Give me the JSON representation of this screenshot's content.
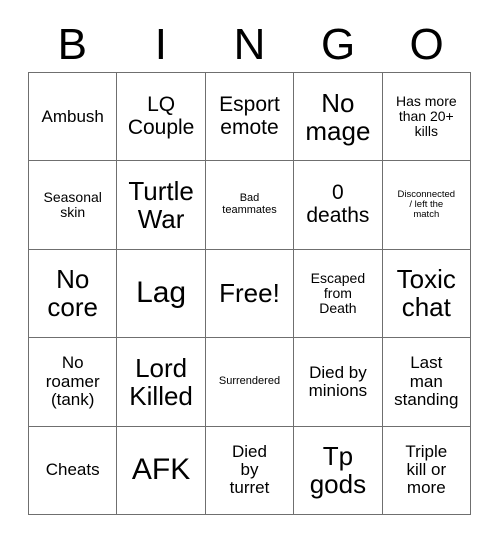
{
  "card": {
    "title": "BINGO",
    "headers": [
      "B",
      "I",
      "N",
      "G",
      "O"
    ],
    "rows": [
      [
        {
          "text": "Ambush",
          "size": "fs-m"
        },
        {
          "text": "LQ\nCouple",
          "size": "fs-l"
        },
        {
          "text": "Esport\nemote",
          "size": "fs-l"
        },
        {
          "text": "No\nmage",
          "size": "fs-xl"
        },
        {
          "text": "Has more\nthan 20+\nkills",
          "size": "fs-s"
        }
      ],
      [
        {
          "text": "Seasonal\nskin",
          "size": "fs-s"
        },
        {
          "text": "Turtle\nWar",
          "size": "fs-xl"
        },
        {
          "text": "Bad\nteammates",
          "size": "fs-xs"
        },
        {
          "text": "0\ndeaths",
          "size": "fs-l"
        },
        {
          "text": "Disconnected\n/ left the\nmatch",
          "size": "fs-xxs"
        }
      ],
      [
        {
          "text": "No\ncore",
          "size": "fs-xl"
        },
        {
          "text": "Lag",
          "size": "fs-xxl"
        },
        {
          "text": "Free!",
          "size": "fs-xl"
        },
        {
          "text": "Escaped\nfrom\nDeath",
          "size": "fs-s"
        },
        {
          "text": "Toxic\nchat",
          "size": "fs-xl"
        }
      ],
      [
        {
          "text": "No\nroamer\n(tank)",
          "size": "fs-m"
        },
        {
          "text": "Lord\nKilled",
          "size": "fs-xl"
        },
        {
          "text": "Surrendered",
          "size": "fs-xs"
        },
        {
          "text": "Died by\nminions",
          "size": "fs-m"
        },
        {
          "text": "Last\nman\nstanding",
          "size": "fs-m"
        }
      ],
      [
        {
          "text": "Cheats",
          "size": "fs-m"
        },
        {
          "text": "AFK",
          "size": "fs-xxl"
        },
        {
          "text": "Died\nby\nturret",
          "size": "fs-m"
        },
        {
          "text": "Tp\ngods",
          "size": "fs-xl"
        },
        {
          "text": "Triple\nkill or\nmore",
          "size": "fs-m"
        }
      ]
    ]
  },
  "colors": {
    "background": "#ffffff",
    "text": "#000000",
    "grid_line": "#6f6f6f"
  }
}
